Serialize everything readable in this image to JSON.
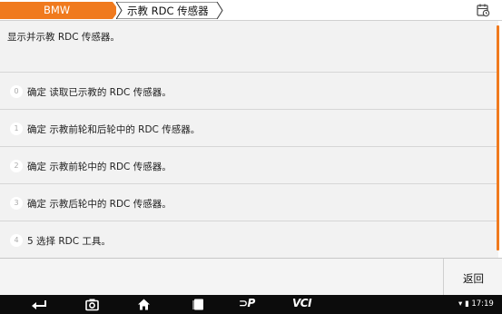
{
  "breadcrumb": {
    "home": "BMW",
    "current": "示教 RDC 传感器"
  },
  "description": "显示并示教 RDC 传感器。",
  "items": [
    {
      "index": "0",
      "label": "确定  读取已示教的 RDC 传感器。"
    },
    {
      "index": "1",
      "label": "确定  示教前轮和后轮中的 RDC 传感器。"
    },
    {
      "index": "2",
      "label": "确定  示教前轮中的 RDC 传感器。"
    },
    {
      "index": "3",
      "label": "确定  示教后轮中的 RDC 传感器。"
    },
    {
      "index": "4",
      "label": "5  选择 RDC 工具。"
    }
  ],
  "actions": {
    "back": "返回"
  },
  "navbar": {
    "dp_label": "⊃P",
    "vci_label": "VCI",
    "status": "▾ ▮ 17:19"
  },
  "colors": {
    "accent": "#f07a1e",
    "row_bg": "#f2f2f2",
    "navbar_bg": "#0c0c0c"
  }
}
